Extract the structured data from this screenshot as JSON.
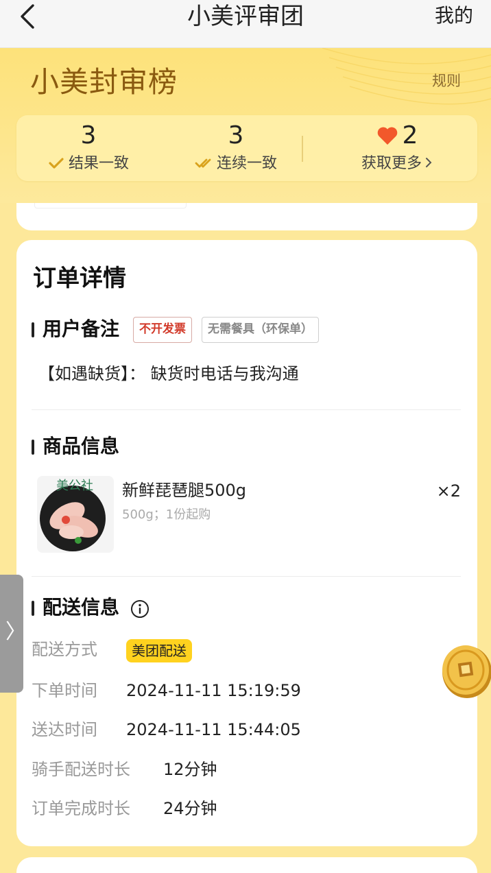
{
  "nav": {
    "title": "小美评审团",
    "right": "我的"
  },
  "hero": {
    "title": "小美封审榜",
    "rule_link": "规则"
  },
  "stats": [
    {
      "value": "3",
      "label": "结果一致",
      "icon": "check-icon"
    },
    {
      "value": "3",
      "label": "连续一致",
      "icon": "double-check-icon"
    },
    {
      "value": "2",
      "label": "获取更多",
      "icon": "heart-icon"
    }
  ],
  "order": {
    "section_title": "订单详情",
    "remark_heading": "用户备注",
    "tags": [
      "不开发票",
      "无需餐具（环保单）"
    ],
    "remark_text": "【如遇缺货】： 缺货时电话与我沟通",
    "product_heading": "商品信息",
    "product": {
      "name": "新鲜琵琶腿500g",
      "spec": "500g；1份起购",
      "qty": "×2",
      "image_text": "美公社"
    },
    "delivery_heading": "配送信息",
    "delivery_rows": [
      {
        "label": "配送方式",
        "value": "美团配送"
      },
      {
        "label": "下单时间",
        "value": "2024-11-11 15:19:59"
      },
      {
        "label": "送达时间",
        "value": "2024-11-11 15:44:05"
      },
      {
        "label": "骑手配送时长",
        "value": "12分钟"
      },
      {
        "label": "订单完成时长",
        "value": "24分钟"
      }
    ]
  },
  "side_handle": "〉",
  "colors": {
    "accent": "#ffd21f",
    "bg": "#fde89a",
    "heart": "#f2582b"
  }
}
